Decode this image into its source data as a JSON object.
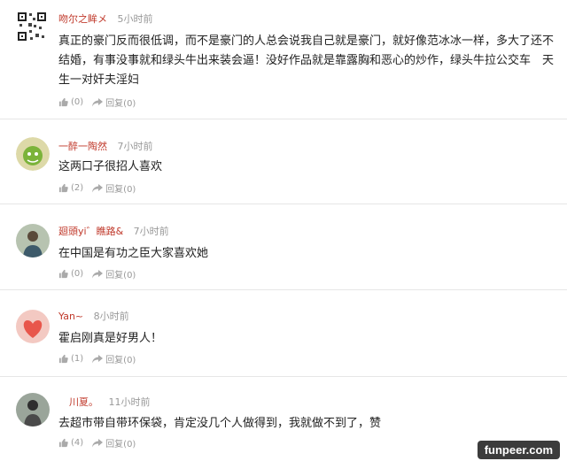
{
  "comments": [
    {
      "username": "吻尔之眸メ",
      "time": "5小时前",
      "text": "真正的豪门反而很低调，而不是豪门的人总会说我自己就是豪门，就好像范冰冰一样，多大了还不结婚，有事没事就和绿头牛出来装会逼！没好作品就是靠露胸和恶心的炒作，绿头牛拉公交车　天生一对奸夫淫妇",
      "likes": "(0)",
      "reply": "回复(0)",
      "avatar_icon": "qr-code-avatar-icon"
    },
    {
      "username": "一醉一陶然",
      "time": "7小时前",
      "text": "这两口子很招人喜欢",
      "likes": "(2)",
      "reply": "回复(0)",
      "avatar_icon": "cartoon-avatar-icon"
    },
    {
      "username": "廻頭yi゛瞧路&",
      "time": "7小时前",
      "text": "在中国是有功之臣大家喜欢她",
      "likes": "(0)",
      "reply": "回复(0)",
      "avatar_icon": "person-photo-avatar-icon"
    },
    {
      "username": "Yan~",
      "time": "8小时前",
      "text": "霍启刚真是好男人！",
      "likes": "(1)",
      "reply": "回复(0)",
      "avatar_icon": "heart-avatar-icon"
    },
    {
      "username": "川夏。",
      "time": "11小时前",
      "text": "去超市带自带环保袋，肯定没几个人做得到，我就做不到了，赞",
      "likes": "(4)",
      "reply": "回复(0)",
      "avatar_icon": "person-photo-avatar-icon"
    }
  ],
  "watermark": "funpeer.com",
  "colors": {
    "username": "#c0392b",
    "meta": "#999999",
    "divider": "#e6e6e6"
  }
}
